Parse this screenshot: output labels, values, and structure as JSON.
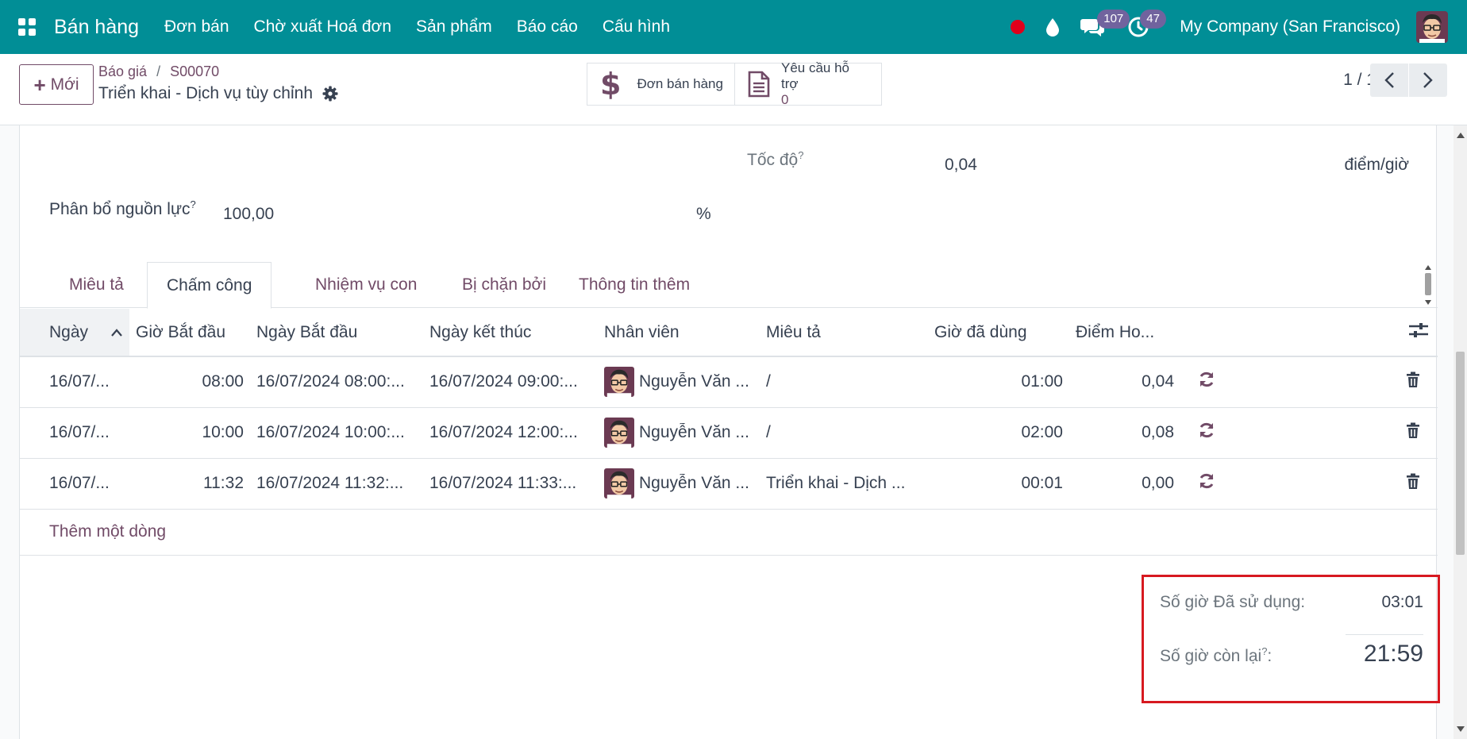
{
  "navbar": {
    "brand": "Bán hàng",
    "menu": [
      "Đơn bán",
      "Chờ xuất Hoá đơn",
      "Sản phẩm",
      "Báo cáo",
      "Cấu hình"
    ],
    "messages_count": "107",
    "activities_count": "47",
    "company": "My Company (San Francisco)",
    "status_dot_color": "#e0001b"
  },
  "control": {
    "new_label": "Mới",
    "breadcrumb": [
      "Báo giá",
      "S00070"
    ],
    "record_title": "Triển khai - Dịch vụ tùy chỉnh",
    "smart_sale_order": "Đơn bán hàng",
    "smart_ticket_label": "Yêu cầu hỗ trợ",
    "smart_ticket_count": "0",
    "pager": "1 / 1"
  },
  "form": {
    "speed_label": "Tốc độ",
    "speed_value": "0,04",
    "speed_unit": "điểm/giờ",
    "allocation_label": "Phân bổ nguồn lực",
    "allocation_value": "100,00",
    "allocation_unit": "%"
  },
  "tabs": [
    "Miêu tả",
    "Chấm công",
    "Nhiệm vụ con",
    "Bị chặn bởi",
    "Thông tin thêm"
  ],
  "active_tab": "Chấm công",
  "timesheet": {
    "columns": [
      "Ngày",
      "Giờ Bắt đầu",
      "Ngày Bắt đầu",
      "Ngày kết thúc",
      "Nhân viên",
      "Miêu tả",
      "Giờ đã dùng",
      "Điểm Ho..."
    ],
    "rows": [
      {
        "date": "16/07/...",
        "start_time": "08:00",
        "start_date": "16/07/2024 08:00:...",
        "end_date": "16/07/2024 09:00:...",
        "employee": "Nguyễn Văn ...",
        "description": "/",
        "hours": "01:00",
        "points": "0,04"
      },
      {
        "date": "16/07/...",
        "start_time": "10:00",
        "start_date": "16/07/2024 10:00:...",
        "end_date": "16/07/2024 12:00:...",
        "employee": "Nguyễn Văn ...",
        "description": "/",
        "hours": "02:00",
        "points": "0,08"
      },
      {
        "date": "16/07/...",
        "start_time": "11:32",
        "start_date": "16/07/2024 11:32:...",
        "end_date": "16/07/2024 11:33:...",
        "employee": "Nguyễn Văn ...",
        "description": "Triển khai - Dịch ...",
        "hours": "00:01",
        "points": "0,00"
      }
    ],
    "add_line": "Thêm một dòng"
  },
  "summary": {
    "used_label": "Số giờ Đã sử dụng:",
    "used_value": "03:01",
    "remaining_label": "Số giờ còn lại",
    "remaining_value": "21:59"
  },
  "colors": {
    "navbar": "#018e96",
    "accent": "#714b67",
    "highlight_box": "#d71920"
  }
}
